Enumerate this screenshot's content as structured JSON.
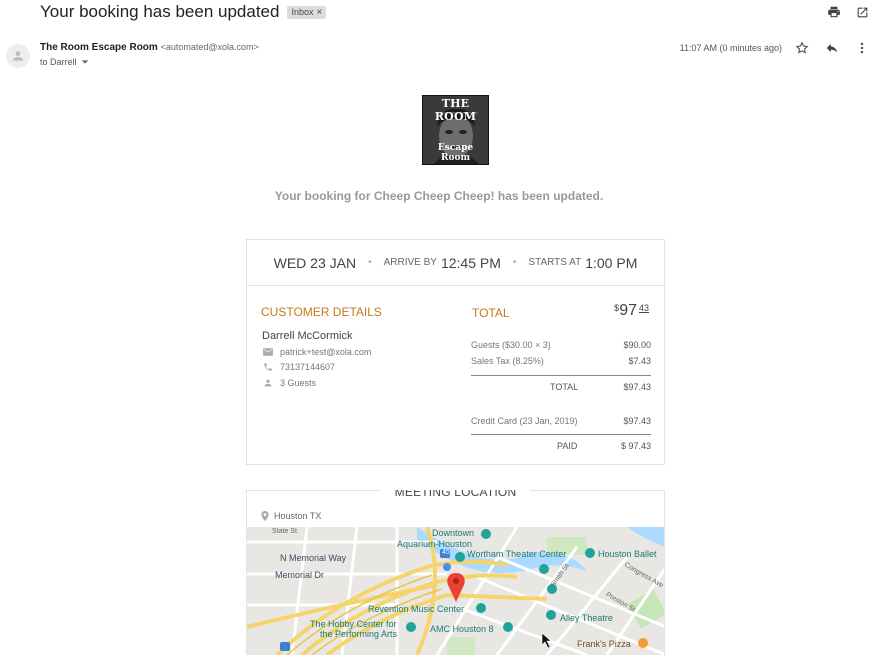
{
  "email": {
    "subject": "Your booking has been updated",
    "label": "Inbox",
    "label_close": "×",
    "sender_name": "The Room Escape Room",
    "sender_address": "<automated@xola.com>",
    "to_line": "to Darrell",
    "time": "11:07 AM (0 minutes ago)"
  },
  "logo": {
    "top_text": "THE ROOM",
    "bottom_text": "Escape Room"
  },
  "headline": "Your booking for Cheep Cheep Cheep! has been updated.",
  "booking": {
    "date": "WED 23 JAN",
    "arrive_label": "ARRIVE BY",
    "arrive_time": "12:45 PM",
    "starts_label": "STARTS AT",
    "starts_time": "1:00 PM",
    "separator": "•"
  },
  "customer": {
    "title": "CUSTOMER DETAILS",
    "name": "Darrell McCormick",
    "email": "patrick+test@xola.com",
    "phone": "73137144607",
    "guests": "3 Guests"
  },
  "total": {
    "title": "TOTAL",
    "currency": "$",
    "dollars": "97",
    "cents": "43",
    "lines": [
      {
        "label": "Guests ($30.00 × 3)",
        "value": "$90.00"
      },
      {
        "label": "Sales Tax (8.25%)",
        "value": "$7.43"
      }
    ],
    "subtotal_label": "TOTAL",
    "subtotal_value": "$97.43",
    "payment_label": "Credit Card (23 Jan, 2019)",
    "payment_value": "$97.43",
    "paid_label": "PAID",
    "paid_value": "$ 97.43"
  },
  "location": {
    "title": "MEETING LOCATION",
    "address": "Houston TX"
  },
  "map": {
    "labels": {
      "state": "State St",
      "memorial_way": "N Memorial Way",
      "memorial_dr": "Memorial Dr",
      "downtown": "Downtown",
      "aquarium": "Aquarium-Houston",
      "wortham": "Wortham Theater Center",
      "ballet": "Houston Ballet",
      "congress": "Congress Ave",
      "preston": "Preston St",
      "smith": "Smith St",
      "revention": "Revention Music Center",
      "hobby1": "The Hobby Center for",
      "hobby2": "the Performing Arts",
      "amc": "AMC Houston 8",
      "alley": "Alley Theatre",
      "franks": "Frank's Pizza",
      "i45": "45"
    }
  },
  "colors": {
    "accent": "#c47a1a",
    "pin": "#ea4335",
    "poi": "#1fa39a"
  },
  "icons": [
    "print-icon",
    "open-in-new-icon",
    "star-icon",
    "reply-icon",
    "more-vert-icon",
    "mail-icon",
    "phone-icon",
    "person-icon",
    "pin-icon"
  ]
}
